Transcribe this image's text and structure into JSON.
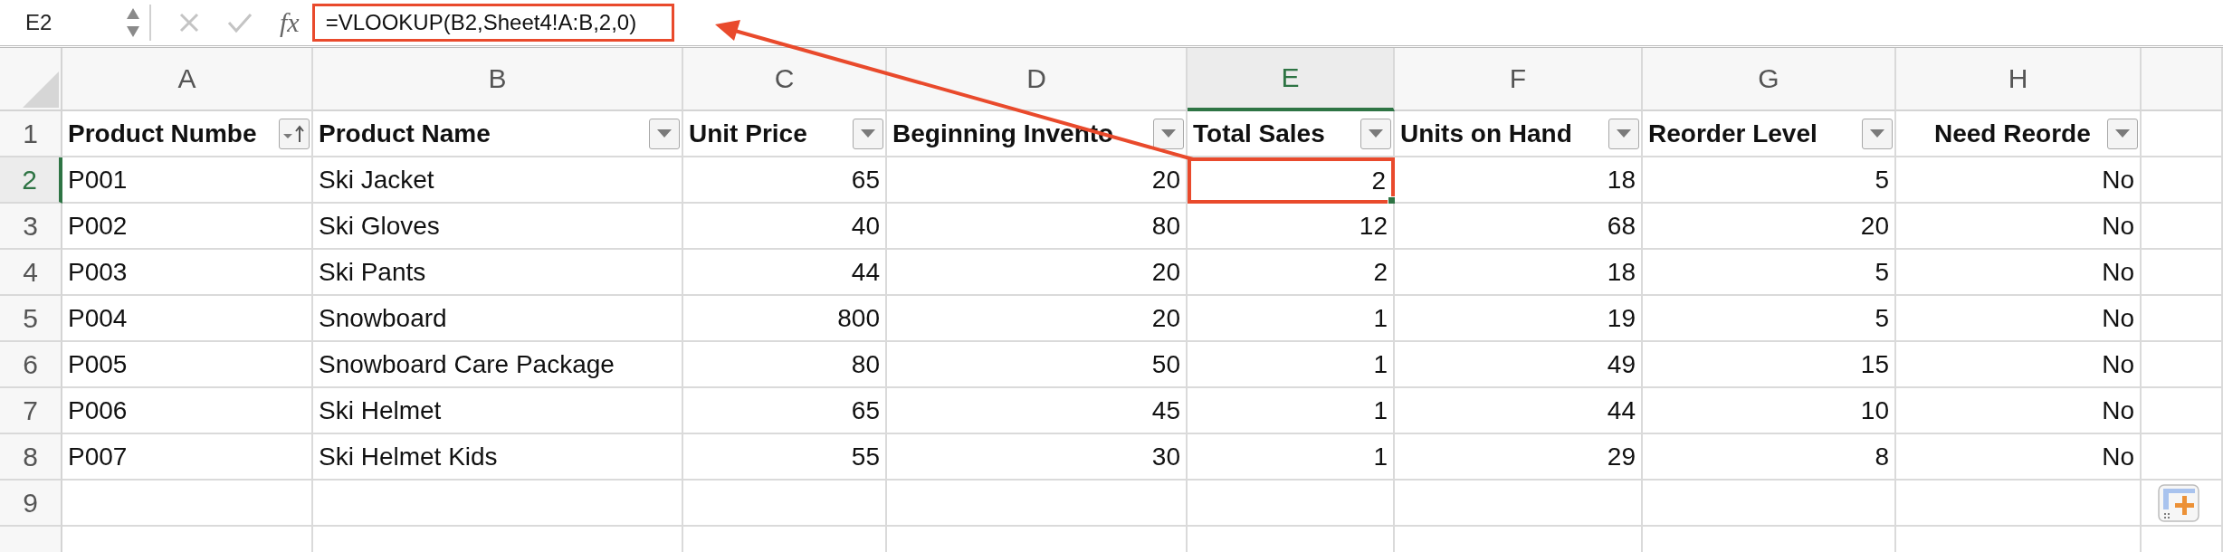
{
  "formula_bar": {
    "name_box": "E2",
    "function_label": "fx",
    "formula": "=VLOOKUP(B2,Sheet4!A:B,2,0)",
    "highlighted": true
  },
  "columns": [
    {
      "label": "A",
      "selected": false,
      "kind": "text"
    },
    {
      "label": "B",
      "selected": false,
      "kind": "text"
    },
    {
      "label": "C",
      "selected": false,
      "kind": "number"
    },
    {
      "label": "D",
      "selected": false,
      "kind": "number"
    },
    {
      "label": "E",
      "selected": true,
      "kind": "number"
    },
    {
      "label": "F",
      "selected": false,
      "kind": "number"
    },
    {
      "label": "G",
      "selected": false,
      "kind": "number"
    },
    {
      "label": "H",
      "selected": false,
      "kind": "number"
    }
  ],
  "header_row": {
    "number": "1",
    "selected": false,
    "cells": [
      {
        "text": "Product Numbe",
        "kind": "sorted"
      },
      {
        "text": "Product Name",
        "kind": "dropdown"
      },
      {
        "text": "Unit Price",
        "kind": "dropdown"
      },
      {
        "text": "Beginning Invento",
        "kind": "dropdown"
      },
      {
        "text": "Total Sales",
        "kind": "dropdown"
      },
      {
        "text": "Units on Hand",
        "kind": "dropdown"
      },
      {
        "text": "Reorder Level",
        "kind": "dropdown"
      },
      {
        "text": "Need Reorde",
        "kind": "dropdown"
      }
    ]
  },
  "rows": [
    {
      "number": "2",
      "selected": true,
      "cells": [
        "P001",
        "Ski Jacket",
        "65",
        "20",
        "2",
        "18",
        "5",
        "No"
      ]
    },
    {
      "number": "3",
      "selected": false,
      "cells": [
        "P002",
        "Ski Gloves",
        "40",
        "80",
        "12",
        "68",
        "20",
        "No"
      ]
    },
    {
      "number": "4",
      "selected": false,
      "cells": [
        "P003",
        "Ski Pants",
        "44",
        "20",
        "2",
        "18",
        "5",
        "No"
      ]
    },
    {
      "number": "5",
      "selected": false,
      "cells": [
        "P004",
        "Snowboard",
        "800",
        "20",
        "1",
        "19",
        "5",
        "No"
      ]
    },
    {
      "number": "6",
      "selected": false,
      "cells": [
        "P005",
        "Snowboard Care Package",
        "80",
        "50",
        "1",
        "49",
        "15",
        "No"
      ]
    },
    {
      "number": "7",
      "selected": false,
      "cells": [
        "P006",
        "Ski Helmet",
        "65",
        "45",
        "1",
        "44",
        "10",
        "No"
      ]
    },
    {
      "number": "8",
      "selected": false,
      "cells": [
        "P007",
        "Ski Helmet Kids",
        "55",
        "30",
        "1",
        "29",
        "8",
        "No"
      ]
    },
    {
      "number": "9",
      "selected": false
    }
  ]
}
